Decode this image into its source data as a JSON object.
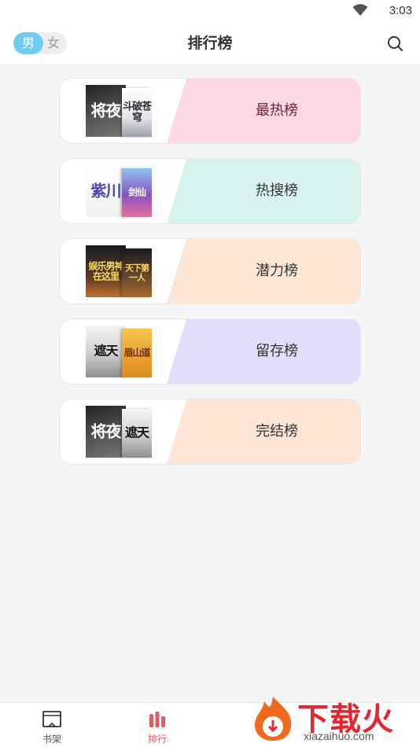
{
  "status_bar": {
    "time": "3:03",
    "wifi_icon": "wifi-icon"
  },
  "header": {
    "gender_male": "男",
    "gender_female": "女",
    "title": "排行榜",
    "search_icon": "search-icon"
  },
  "rankings": [
    {
      "label": "最热榜",
      "color": "#fdd9e4",
      "text_color": "#6b1d3a",
      "covers": [
        {
          "title": "将夜",
          "style": "cv-dark"
        },
        {
          "title": "斗破苍穹",
          "style": "cv-ink"
        }
      ]
    },
    {
      "label": "热搜榜",
      "color": "#d8f3ee",
      "text_color": "#333333",
      "covers": [
        {
          "title": "紫川",
          "style": "cv-ink2"
        },
        {
          "title": "剑仙",
          "style": "cv-purple"
        }
      ]
    },
    {
      "label": "潜力榜",
      "color": "#fde6d6",
      "text_color": "#333333",
      "covers": [
        {
          "title": "娱乐男神在这里",
          "style": "cv-night"
        },
        {
          "title": "天下第一人",
          "style": "cv-fire"
        }
      ]
    },
    {
      "label": "留存榜",
      "color": "#e3dcfb",
      "text_color": "#333333",
      "covers": [
        {
          "title": "遮天",
          "style": "cv-gray"
        },
        {
          "title": "眉山道",
          "style": "cv-gold"
        }
      ]
    },
    {
      "label": "完结榜",
      "color": "#fde6d6",
      "text_color": "#333333",
      "covers": [
        {
          "title": "将夜",
          "style": "cv-dark"
        },
        {
          "title": "遮天",
          "style": "cv-gray"
        }
      ]
    }
  ],
  "tab_bar": {
    "bookshelf": "书架",
    "ranking": "排行"
  },
  "watermark": {
    "title": "下载火",
    "url": "xiazaihuo.com"
  }
}
